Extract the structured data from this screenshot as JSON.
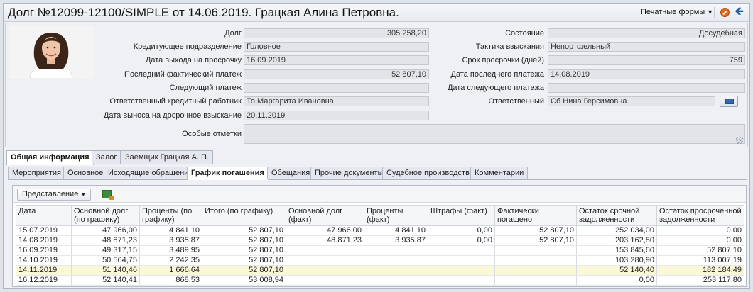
{
  "window": {
    "title": "Долг №12099-12100/SIMPLE от 14.06.2019. Грацкая Алина Петровна.",
    "print_forms_label": "Печатные формы"
  },
  "fields_left": [
    {
      "label": "Долг",
      "value": "305 258,20",
      "align": "right"
    },
    {
      "label": "Кредитующее подразделение",
      "value": "Головное",
      "align": "left"
    },
    {
      "label": "Дата выхода на просрочку",
      "value": "16.09.2019",
      "align": "left"
    },
    {
      "label": "Последний фактический платеж",
      "value": "52 807,10",
      "align": "right"
    },
    {
      "label": "Следующий платеж",
      "value": "",
      "align": "left"
    },
    {
      "label": "Ответственный кредитный работник",
      "value": "То Маргарита Ивановна",
      "align": "left"
    },
    {
      "label": "Дата выноса на досрочное взыскание",
      "value": "20.11.2019",
      "align": "left"
    }
  ],
  "fields_right": [
    {
      "label": "Состояние",
      "value": "Досудебная",
      "align": "right"
    },
    {
      "label": "Тактика взыскания",
      "value": "Непортфельный",
      "align": "left"
    },
    {
      "label": "Срок просрочки (дней)",
      "value": "759",
      "align": "right"
    },
    {
      "label": "Дата последнего платежа",
      "value": "14.08.2019",
      "align": "left"
    },
    {
      "label": "Дата следующего платежа",
      "value": "",
      "align": "left"
    },
    {
      "label": "Ответственный",
      "value": "Сб Нина Герсимовна",
      "align": "left"
    }
  ],
  "notes": {
    "label": "Особые отметки",
    "value": ""
  },
  "main_tabs": [
    {
      "label": "Общая информация",
      "active": true
    },
    {
      "label": "Залог",
      "active": false
    },
    {
      "label": "Заемщик Грацкая А. П.",
      "active": false
    }
  ],
  "sub_tabs": [
    {
      "label": "Мероприятия",
      "active": false
    },
    {
      "label": "Основное",
      "active": false
    },
    {
      "label": "Исходящие обращения",
      "active": false
    },
    {
      "label": "График погашения",
      "active": true
    },
    {
      "label": "Обещания",
      "active": false
    },
    {
      "label": "Прочие документы",
      "active": false
    },
    {
      "label": "Судебное производство",
      "active": false
    },
    {
      "label": "Комментарии",
      "active": false
    }
  ],
  "grid": {
    "present_label": "Представление",
    "columns": [
      "Дата",
      "Основной долг (по графику)",
      "Проценты (по графику)",
      "Итого (по графику)",
      "Основной долг (факт)",
      "Проценты (факт)",
      "Штрафы (факт)",
      "Фактически погашено",
      "Остаток срочной задолженности",
      "Остаток просроченной задолженности"
    ],
    "rows": [
      [
        "15.07.2019",
        "47 966,00",
        "4 841,10",
        "52 807,10",
        "47 966,00",
        "4 841,10",
        "0,00",
        "52 807,10",
        "252 034,00",
        "0,00"
      ],
      [
        "14.08.2019",
        "48 871,23",
        "3 935,87",
        "52 807,10",
        "48 871,23",
        "3 935,87",
        "0,00",
        "52 807,10",
        "203 162,80",
        "0,00"
      ],
      [
        "16.09.2019",
        "49 317,15",
        "3 489,95",
        "52 807,10",
        "",
        "",
        "",
        "",
        "153 845,60",
        "52 807,10"
      ],
      [
        "14.10.2019",
        "50 564,75",
        "2 242,35",
        "52 807,10",
        "",
        "",
        "",
        "",
        "103 280,90",
        "113 007,19"
      ],
      [
        "14.11.2019",
        "51 140,46",
        "1 666,64",
        "52 807,10",
        "",
        "",
        "",
        "",
        "52 140,40",
        "182 184,49"
      ],
      [
        "16.12.2019",
        "52 140,41",
        "868,53",
        "53 008,94",
        "",
        "",
        "",
        "",
        "0,00",
        "253 117,80"
      ]
    ],
    "selected_row": 4
  }
}
